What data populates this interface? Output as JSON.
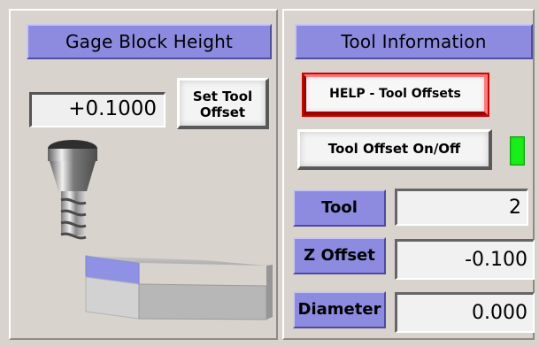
{
  "headers": {
    "gage_block": "Gage Block Height",
    "tool_info": "Tool Information"
  },
  "gage_block": {
    "value": "+0.1000"
  },
  "buttons": {
    "set_tool_offset": "Set Tool\nOffset",
    "help_tool_offsets": "HELP - Tool Offsets",
    "tool_offset_toggle": "Tool Offset On/Off"
  },
  "labels": {
    "tool": "Tool",
    "z_offset": "Z Offset",
    "diameter": "Diameter"
  },
  "values": {
    "tool": "2",
    "z_offset": "-0.100",
    "diameter": "0.000"
  },
  "indicator": {
    "tool_offset_on": true,
    "color": "#17ef17"
  },
  "icons": {
    "illustration": "tool-and-gage-block-icon"
  },
  "colors": {
    "background": "#d8d4cd",
    "header": "#8c8be0",
    "label": "#8c8be0",
    "help_border": "#d30000"
  }
}
